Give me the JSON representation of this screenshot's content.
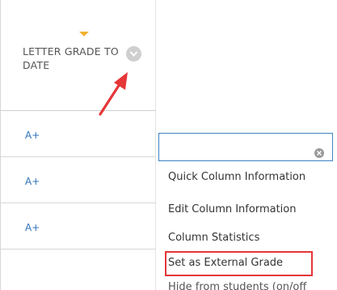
{
  "column": {
    "header_label": "LETTER GRADE TO DATE",
    "grades": [
      "A+",
      "A+",
      "A+"
    ]
  },
  "menu": {
    "search_value": "",
    "items": [
      "Quick Column Information",
      "Edit Column Information",
      "Column Statistics",
      "Set as External Grade",
      "Hide from students (on/off"
    ],
    "highlighted_item": "Set as External Grade"
  },
  "colors": {
    "link_blue": "#2b72b8",
    "sort_indicator": "#f2b233",
    "annotation_red": "#e53638",
    "input_border": "#3d82c4"
  },
  "icons": {
    "header_menu": "chevron-down-icon",
    "sort": "sort-triangle-icon",
    "clear": "clear-x-icon",
    "annotation": "red-arrow-icon"
  }
}
